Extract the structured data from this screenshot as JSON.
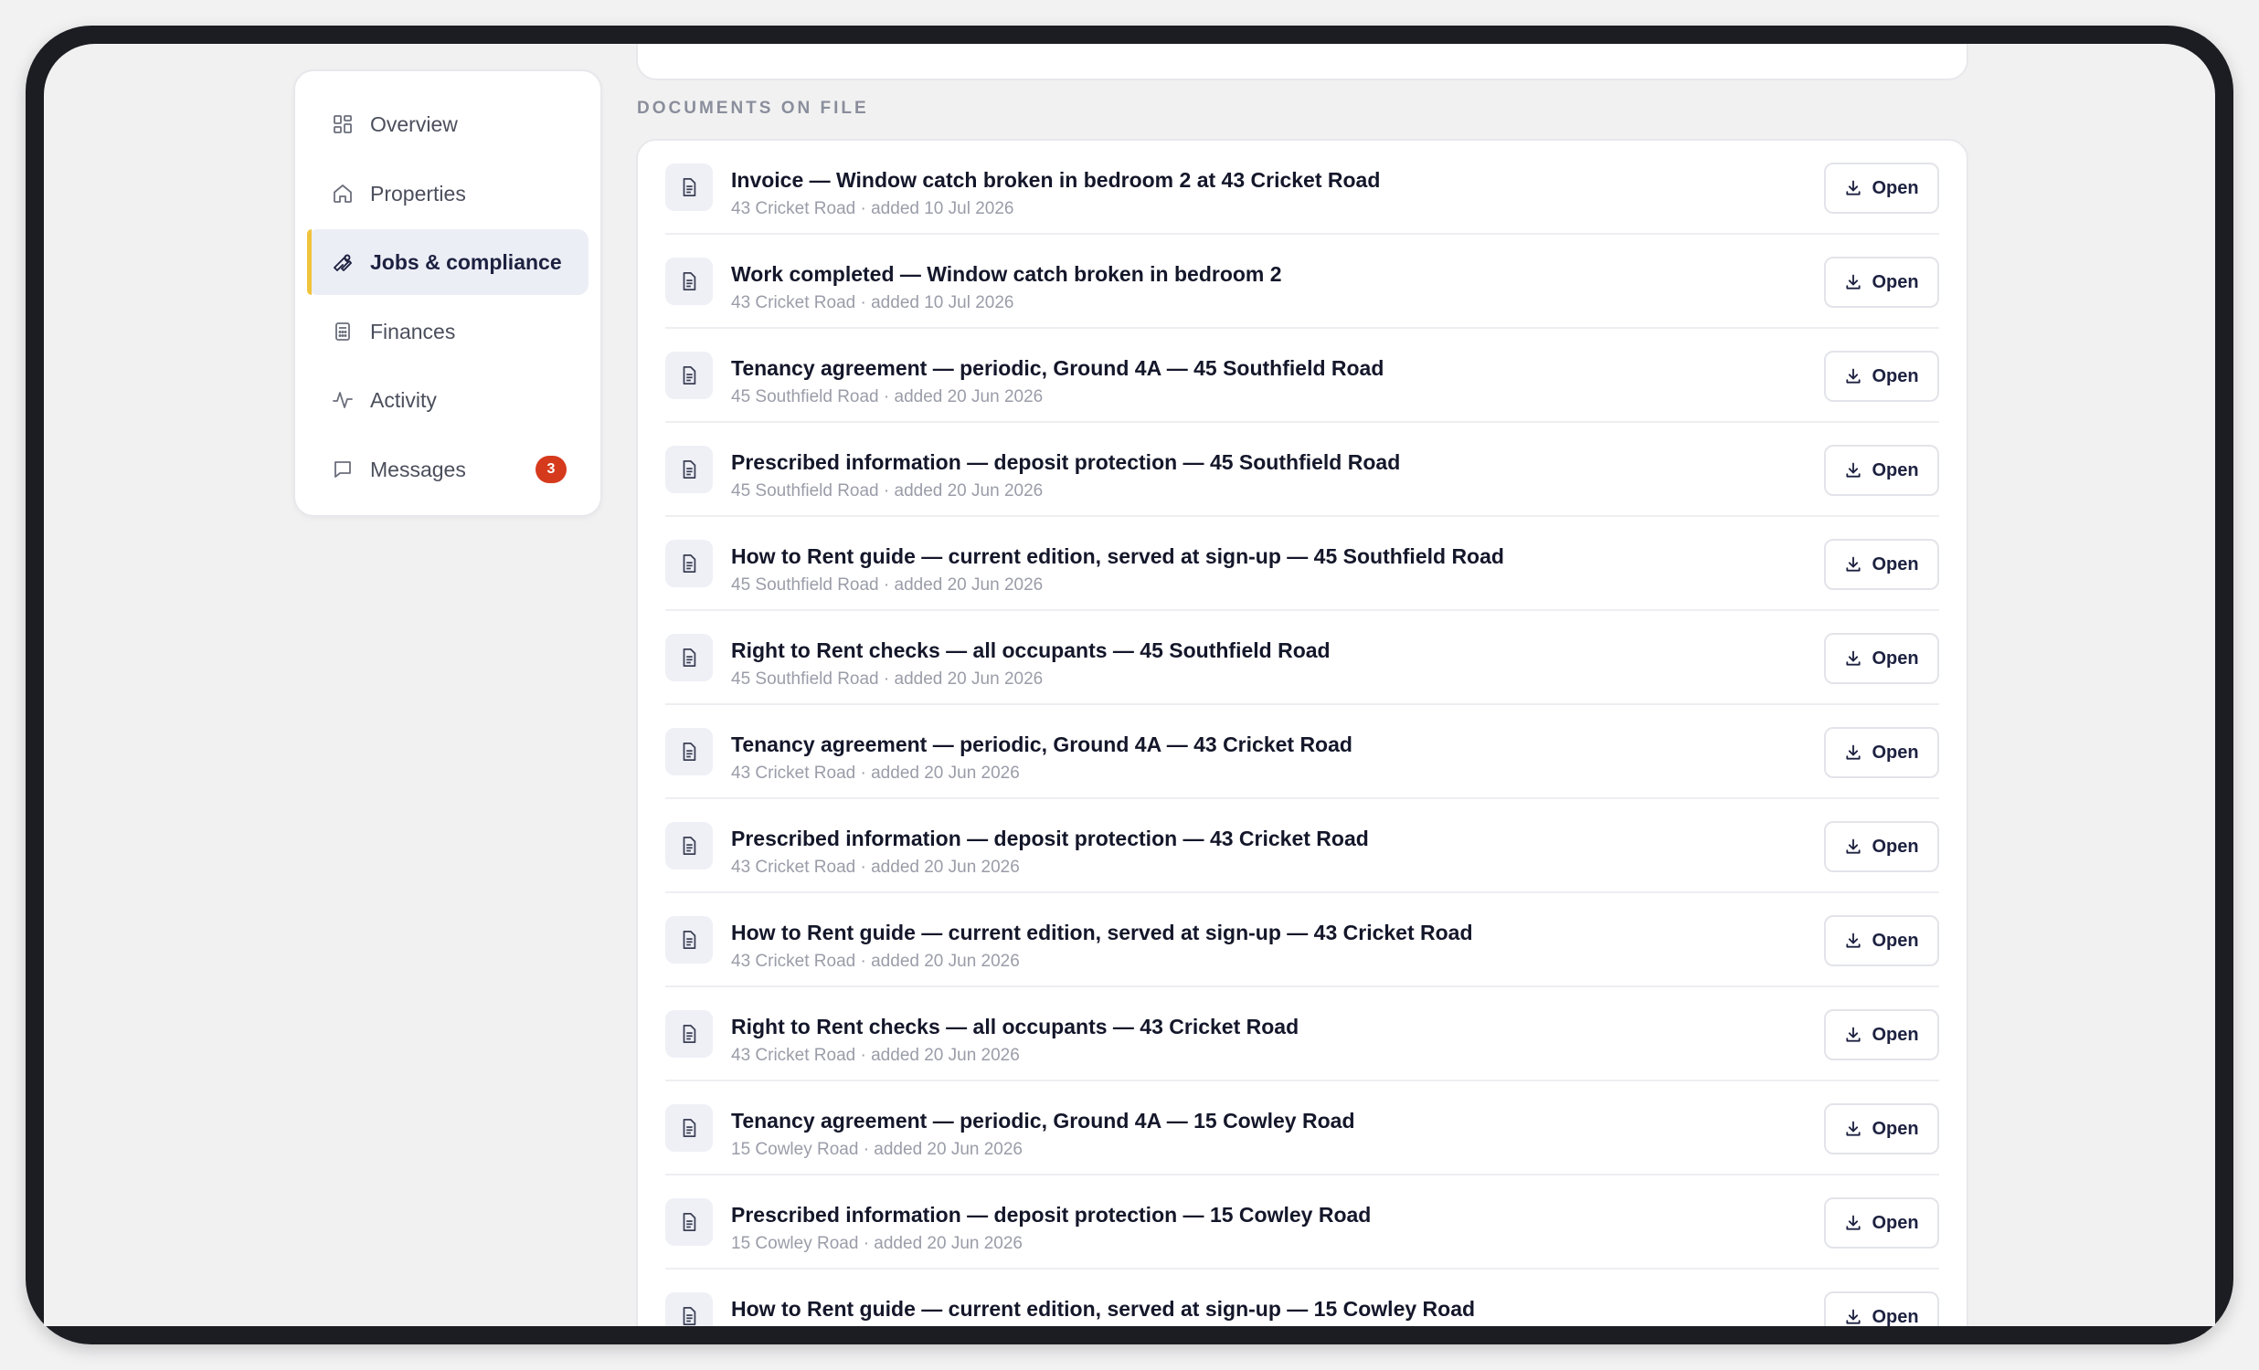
{
  "sidebar": {
    "items": [
      {
        "label": "Overview",
        "icon": "grid-icon"
      },
      {
        "label": "Properties",
        "icon": "home-icon"
      },
      {
        "label": "Jobs & compliance",
        "icon": "wrench-icon",
        "active": true
      },
      {
        "label": "Finances",
        "icon": "calculator-icon"
      },
      {
        "label": "Activity",
        "icon": "pulse-icon"
      },
      {
        "label": "Messages",
        "icon": "chat-icon",
        "badge": "3"
      }
    ]
  },
  "documents": {
    "section_label": "DOCUMENTS ON FILE",
    "open_label": "Open",
    "rows": [
      {
        "title": "Invoice — Window catch broken in bedroom 2 at 43 Cricket Road",
        "meta": "43 Cricket Road · added 10 Jul 2026"
      },
      {
        "title": "Work completed — Window catch broken in bedroom 2",
        "meta": "43 Cricket Road · added 10 Jul 2026"
      },
      {
        "title": "Tenancy agreement — periodic, Ground 4A — 45 Southfield Road",
        "meta": "45 Southfield Road · added 20 Jun 2026"
      },
      {
        "title": "Prescribed information — deposit protection — 45 Southfield Road",
        "meta": "45 Southfield Road · added 20 Jun 2026"
      },
      {
        "title": "How to Rent guide — current edition, served at sign-up — 45 Southfield Road",
        "meta": "45 Southfield Road · added 20 Jun 2026"
      },
      {
        "title": "Right to Rent checks — all occupants — 45 Southfield Road",
        "meta": "45 Southfield Road · added 20 Jun 2026"
      },
      {
        "title": "Tenancy agreement — periodic, Ground 4A — 43 Cricket Road",
        "meta": "43 Cricket Road · added 20 Jun 2026"
      },
      {
        "title": "Prescribed information — deposit protection — 43 Cricket Road",
        "meta": "43 Cricket Road · added 20 Jun 2026"
      },
      {
        "title": "How to Rent guide — current edition, served at sign-up — 43 Cricket Road",
        "meta": "43 Cricket Road · added 20 Jun 2026"
      },
      {
        "title": "Right to Rent checks — all occupants — 43 Cricket Road",
        "meta": "43 Cricket Road · added 20 Jun 2026"
      },
      {
        "title": "Tenancy agreement — periodic, Ground 4A — 15 Cowley Road",
        "meta": "15 Cowley Road · added 20 Jun 2026"
      },
      {
        "title": "Prescribed information — deposit protection — 15 Cowley Road",
        "meta": "15 Cowley Road · added 20 Jun 2026"
      },
      {
        "title": "How to Rent guide — current edition, served at sign-up — 15 Cowley Road",
        "meta": ""
      }
    ]
  }
}
